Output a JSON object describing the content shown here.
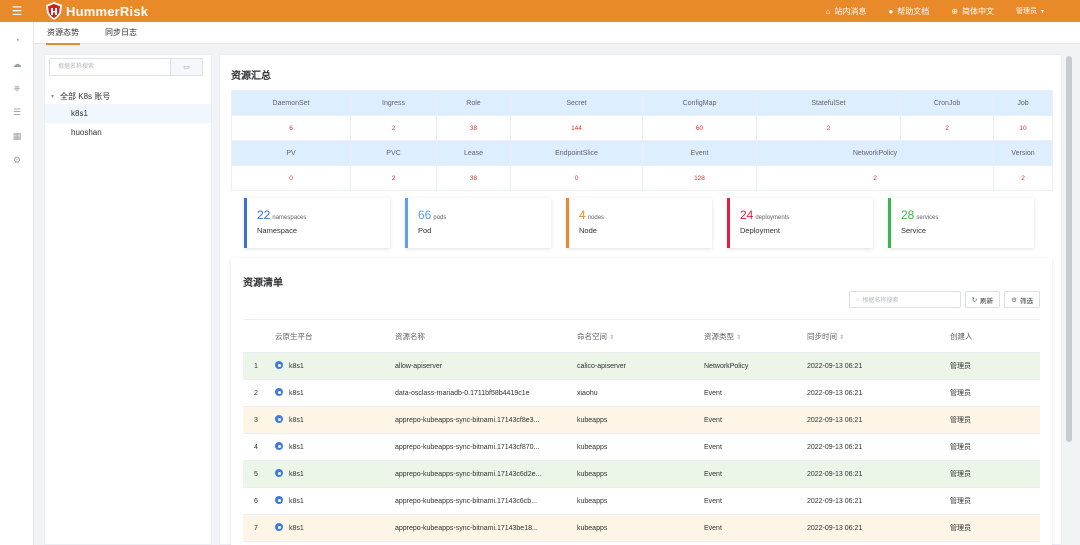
{
  "topbar": {
    "brand": "HummerRisk",
    "links": [
      {
        "icon": "bell-icon",
        "glyph": "♫",
        "label": "站内消息"
      },
      {
        "icon": "help-icon",
        "glyph": "●",
        "label": "帮助文档"
      },
      {
        "icon": "globe-icon",
        "glyph": "⊕",
        "label": "简体中文"
      }
    ],
    "user": "管理员"
  },
  "rail": [
    "dashboard-icon",
    "cloud-icon",
    "k8s-icon",
    "list-icon",
    "apps-icon",
    "settings-icon"
  ],
  "tabs": [
    "资源态势",
    "同步日志"
  ],
  "tree": {
    "search_placeholder": "根据名称搜索",
    "root": "全部 K8s 账号",
    "nodes": [
      "k8s1",
      "huoshan"
    ]
  },
  "summary": {
    "title": "资源汇总",
    "row1_headers": [
      "DaemonSet",
      "Ingress",
      "Role",
      "Secret",
      "ConfigMap",
      "StatefulSet",
      "CronJob",
      "Job"
    ],
    "row1_values": [
      "6",
      "2",
      "38",
      "144",
      "60",
      "2",
      "2",
      "10"
    ],
    "row2_headers": [
      "PV",
      "PVC",
      "Lease",
      "EndpointSlice",
      "Event",
      "NetworkPolicy",
      "Version"
    ],
    "row2_values": [
      "0",
      "2",
      "38",
      "0",
      "128",
      "2",
      "2"
    ]
  },
  "cards": [
    {
      "num": "22",
      "unit": "namespaces",
      "name": "Namespace",
      "color": "#3b6fd0"
    },
    {
      "num": "66",
      "unit": "pods",
      "name": "Pod",
      "color": "#5ea0f0"
    },
    {
      "num": "4",
      "unit": "nodes",
      "name": "Node",
      "color": "#e8892a"
    },
    {
      "num": "24",
      "unit": "deployments",
      "name": "Deployment",
      "color": "#e02040"
    },
    {
      "num": "28",
      "unit": "services",
      "name": "Service",
      "color": "#3bb54a"
    }
  ],
  "list": {
    "title": "资源清单",
    "search_placeholder": "根据名称搜索",
    "refresh": "刷新",
    "filter": "筛选",
    "columns": [
      "",
      "云原生平台",
      "资源名称",
      "命名空间",
      "资源类型",
      "同步时间",
      "创建人"
    ],
    "rows": [
      {
        "idx": "1",
        "platform": "k8s1",
        "name": "allow-apiserver",
        "ns": "calico-apiserver",
        "type": "NetworkPolicy",
        "time": "2022-09-13 06:21",
        "creator": "管理员",
        "tone": "green"
      },
      {
        "idx": "2",
        "platform": "k8s1",
        "name": "data-osclass-mariadb-0.1711bf58b4419c1e",
        "ns": "xiaohu",
        "type": "Event",
        "time": "2022-09-13 06:21",
        "creator": "管理员",
        "tone": "white"
      },
      {
        "idx": "3",
        "platform": "k8s1",
        "name": "apprepo-kubeapps-sync-bitnami.17143cf8e3...",
        "ns": "kubeapps",
        "type": "Event",
        "time": "2022-09-13 06:21",
        "creator": "管理员",
        "tone": "yellow"
      },
      {
        "idx": "4",
        "platform": "k8s1",
        "name": "apprepo-kubeapps-sync-bitnami.17143cf870...",
        "ns": "kubeapps",
        "type": "Event",
        "time": "2022-09-13 06:21",
        "creator": "管理员",
        "tone": "white"
      },
      {
        "idx": "5",
        "platform": "k8s1",
        "name": "apprepo-kubeapps-sync-bitnami.17143c6d2e...",
        "ns": "kubeapps",
        "type": "Event",
        "time": "2022-09-13 06:21",
        "creator": "管理员",
        "tone": "green"
      },
      {
        "idx": "6",
        "platform": "k8s1",
        "name": "apprepo-kubeapps-sync-bitnami.17143c6cb...",
        "ns": "kubeapps",
        "type": "Event",
        "time": "2022-09-13 06:21",
        "creator": "管理员",
        "tone": "white"
      },
      {
        "idx": "7",
        "platform": "k8s1",
        "name": "apprepo-kubeapps-sync-bitnami.17143be18...",
        "ns": "kubeapps",
        "type": "Event",
        "time": "2022-09-13 06:21",
        "creator": "管理员",
        "tone": "yellow"
      }
    ]
  }
}
